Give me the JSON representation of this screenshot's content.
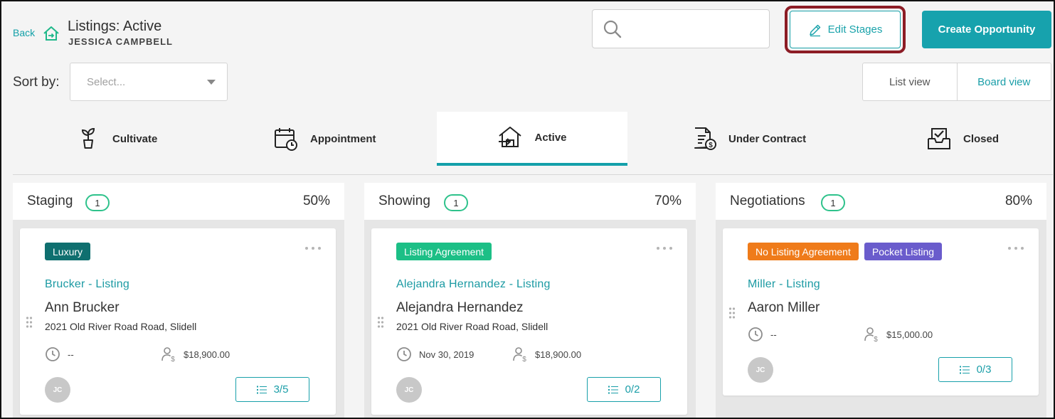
{
  "header": {
    "back_label": "Back",
    "title": "Listings: Active",
    "subtitle": "JESSICA CAMPBELL",
    "search_placeholder": "",
    "edit_stages_label": "Edit Stages",
    "create_label": "Create Opportunity"
  },
  "sort": {
    "label": "Sort by:",
    "placeholder": "Select..."
  },
  "views": {
    "list_label": "List view",
    "board_label": "Board view",
    "selected": "Board view"
  },
  "tabs": [
    {
      "label": "Cultivate",
      "icon": "sprout-icon"
    },
    {
      "label": "Appointment",
      "icon": "calendar-clock-icon"
    },
    {
      "label": "Active",
      "icon": "house-arrow-icon",
      "active": true
    },
    {
      "label": "Under Contract",
      "icon": "document-dollar-icon"
    },
    {
      "label": "Closed",
      "icon": "inbox-check-icon"
    }
  ],
  "columns": [
    {
      "name": "Staging",
      "count": "1",
      "percent": "50%",
      "card": {
        "tags": [
          {
            "label": "Luxury",
            "color": "#0f6f6f"
          }
        ],
        "title": "Brucker - Listing",
        "name": "Ann Brucker",
        "address": "2021 Old River Road Road, Slidell",
        "date": "--",
        "amount": "$18,900.00",
        "avatar": "JC",
        "tasks": "3/5"
      }
    },
    {
      "name": "Showing",
      "count": "1",
      "percent": "70%",
      "card": {
        "tags": [
          {
            "label": "Listing Agreement",
            "color": "#1cbf86"
          }
        ],
        "title": "Alejandra Hernandez - Listing",
        "name": "Alejandra Hernandez",
        "address": "2021 Old River Road Road, Slidell",
        "date": "Nov 30, 2019",
        "amount": "$18,900.00",
        "avatar": "JC",
        "tasks": "0/2"
      }
    },
    {
      "name": "Negotiations",
      "count": "1",
      "percent": "80%",
      "card": {
        "tags": [
          {
            "label": "No Listing Agreement",
            "color": "#ef7b1a"
          },
          {
            "label": "Pocket Listing",
            "color": "#6a5ccc"
          }
        ],
        "title": "Miller - Listing",
        "name": "Aaron Miller",
        "address": "",
        "date": "--",
        "amount": "$15,000.00",
        "avatar": "JC",
        "tasks": "0/3"
      }
    }
  ]
}
